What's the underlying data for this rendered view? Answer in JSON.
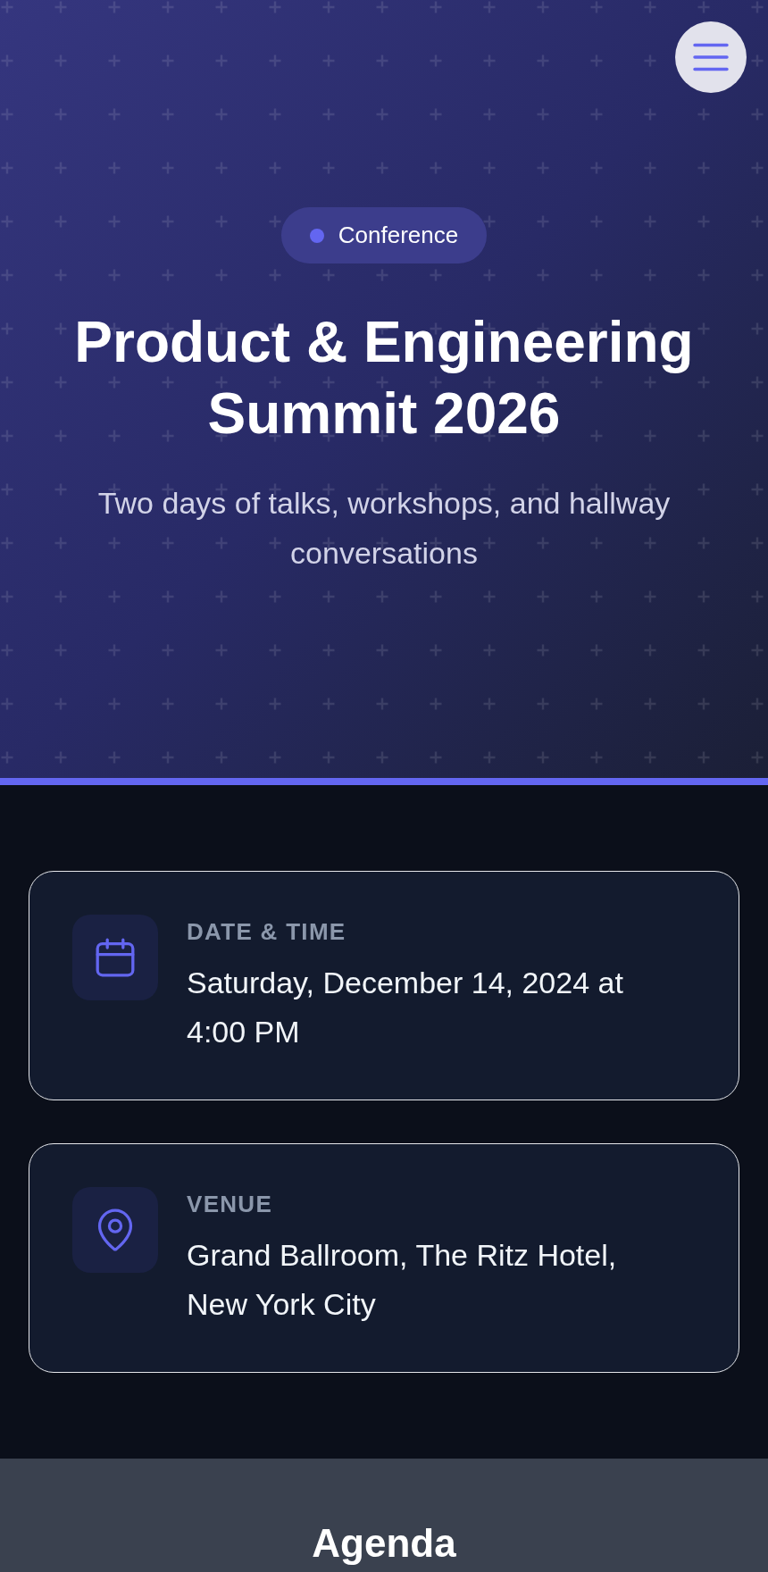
{
  "hero": {
    "badge": {
      "label": "Conference"
    },
    "title": "Product & Engineering Summit 2026",
    "subtitle": "Two days of talks, workshops, and hallway conversations"
  },
  "details": [
    {
      "kind": "date",
      "label": "DATE & TIME",
      "value": "Saturday, December 14, 2024 at 4:00 PM"
    },
    {
      "kind": "venue",
      "label": "VENUE",
      "value": "Grand Ballroom, The Ritz Hotel, New York City"
    }
  ],
  "agenda": {
    "heading": "Agenda"
  }
}
